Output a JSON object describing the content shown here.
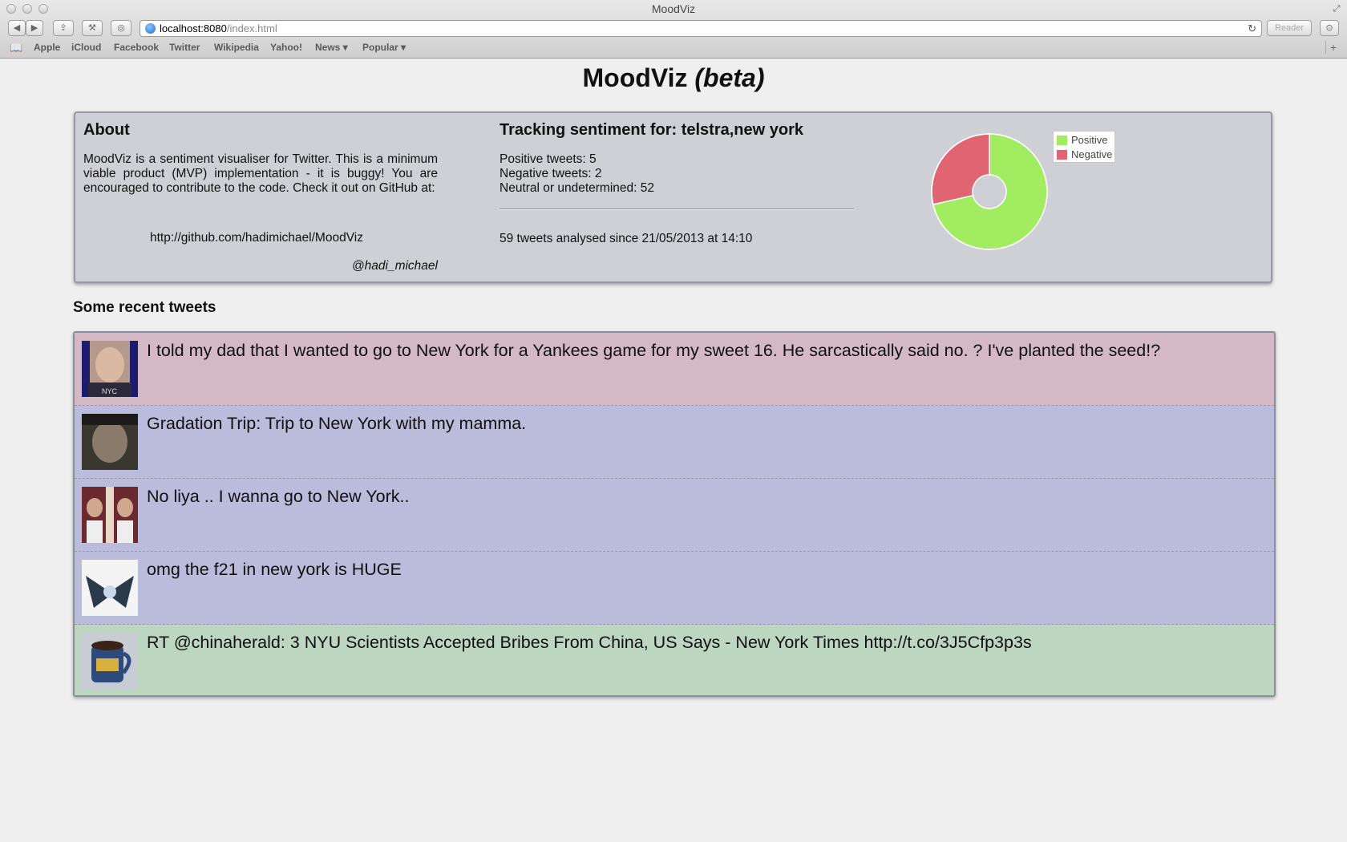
{
  "window": {
    "title": "MoodViz"
  },
  "toolbar": {
    "url_host": "localhost:8080",
    "url_path": "/index.html",
    "reader_label": "Reader"
  },
  "bookmarks": [
    "Apple",
    "iCloud",
    "Facebook",
    "Twitter",
    "Wikipedia",
    "Yahoo!",
    "News ▾",
    "Popular ▾"
  ],
  "header": {
    "title": "MoodViz",
    "beta": "(beta)"
  },
  "about": {
    "heading": "About",
    "text": "MoodViz is a sentiment visualiser for Twitter. This is a minimum viable product (MVP) implementation - it is buggy! You are encouraged to contribute to the code. Check it out on GitHub at:",
    "link": "http://github.com/hadimichael/MoodViz",
    "handle": "@hadi_michael"
  },
  "tracking": {
    "heading": "Tracking sentiment for: telstra,new york",
    "positive": "Positive tweets: 5",
    "negative": "Negative tweets: 2",
    "neutral": "Neutral or undetermined: 52",
    "analysed": "59 tweets analysed since 21/05/2013 at 14:10"
  },
  "chart_data": {
    "type": "pie",
    "categories": [
      "Positive",
      "Negative"
    ],
    "values": [
      5,
      2
    ],
    "colors": [
      "#a2ec62",
      "#e06472"
    ],
    "legend": "right"
  },
  "recent": {
    "heading": "Some recent tweets",
    "tweets": [
      {
        "text": "I told my dad that I wanted to go to New York for a Yankees game for my sweet 16. He sarcastically said no. ? I've planted the seed!?",
        "sentiment": "negative"
      },
      {
        "text": "Gradation Trip: Trip to New York with my mamma.",
        "sentiment": "neutral"
      },
      {
        "text": "No liya .. I wanna go to New York..",
        "sentiment": "neutral"
      },
      {
        "text": "omg the f21 in new york is HUGE",
        "sentiment": "neutral"
      },
      {
        "text": "RT @chinaherald: 3 NYU Scientists Accepted Bribes From China, US Says - New York Times http://t.co/3J5Cfp3p3s",
        "sentiment": "positive"
      }
    ]
  }
}
